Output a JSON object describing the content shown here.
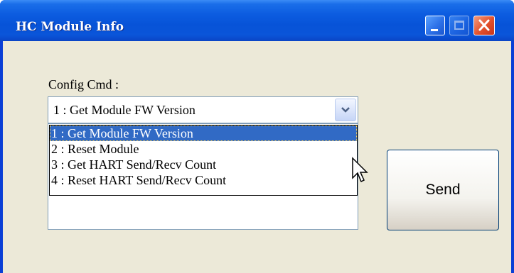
{
  "window": {
    "title": "HC Module Info",
    "controls": [
      "minimize-icon",
      "maximize-icon",
      "close-icon"
    ]
  },
  "config": {
    "label": "Config Cmd :",
    "selected_value": "1 : Get Module FW Version",
    "options": [
      "1 : Get Module FW Version",
      "2 : Reset Module",
      "3 : Get HART Send/Recv Count",
      "4 : Reset HART Send/Recv Count"
    ],
    "highlighted_index": 0
  },
  "send_button": {
    "label": "Send"
  },
  "colors": {
    "titlebar": "#0a55d9",
    "client_bg": "#ece9d8",
    "selection": "#316ac5",
    "close_button": "#e2502b"
  }
}
